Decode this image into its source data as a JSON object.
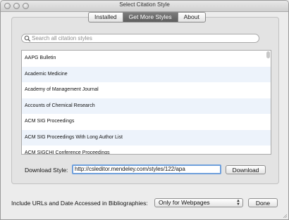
{
  "window": {
    "title": "Select Citation Style"
  },
  "tabs": [
    {
      "label": "Installed",
      "active": false
    },
    {
      "label": "Get More Styles",
      "active": true
    },
    {
      "label": "About",
      "active": false
    }
  ],
  "search": {
    "placeholder": "Search all citation styles",
    "value": ""
  },
  "styles_list": [
    "AAPG Bulletin",
    "Academic Medicine",
    "Academy of Management Journal",
    "Accounts of Chemical Research",
    "ACM SIG Proceedings",
    "ACM SIG Proceedings With Long Author List",
    "ACM SIGCHI Conference Proceedings"
  ],
  "download": {
    "label": "Download Style:",
    "url": "http://csleditor.mendeley.com/styles/122/apa",
    "button": "Download"
  },
  "bibliography": {
    "label": "Include URLs and Date Accessed in Bibliographies:",
    "selected": "Only for Webpages"
  },
  "done_button": "Done",
  "colors": {
    "active_tab": "#6a6a6a",
    "row_alt": "#edf3fb",
    "focus_ring": "#6e9fdc"
  }
}
